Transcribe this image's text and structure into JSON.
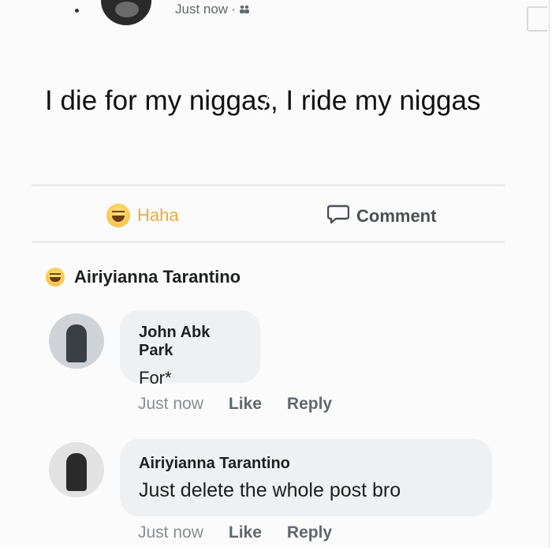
{
  "post": {
    "timestamp": "Just now",
    "separator": "·",
    "audience_icon": "friends-icon",
    "text": "I die for my niggas, I ride my niggas"
  },
  "actions": {
    "reaction_label": "Haha",
    "reaction_icon": "haha-emoji-icon",
    "comment_label": "Comment",
    "comment_icon": "comment-bubble-icon"
  },
  "reactor": {
    "name": "Airiyianna Tarantino",
    "icon": "haha-emoji-icon"
  },
  "comments": [
    {
      "author": "John Abk Park",
      "text": "For*",
      "time": "Just now",
      "like": "Like",
      "reply": "Reply"
    },
    {
      "author": "Airiyianna Tarantino",
      "text": "Just delete the whole post bro",
      "time": "Just now",
      "like": "Like",
      "reply": "Reply"
    }
  ],
  "colors": {
    "haha_accent": "#f0a93a",
    "bubble_bg": "#eff0f2",
    "meta_gray": "#606770"
  }
}
